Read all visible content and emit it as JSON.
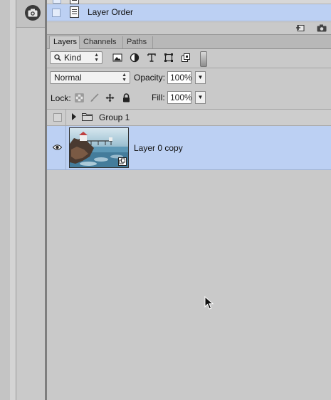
{
  "history": {
    "item_label": "Layer Order"
  },
  "layers_panel": {
    "tabs": [
      {
        "label": "Layers",
        "active": true
      },
      {
        "label": "Channels",
        "active": false
      },
      {
        "label": "Paths",
        "active": false
      }
    ],
    "filter": {
      "kind_label": "Kind"
    },
    "blend_mode": "Normal",
    "opacity_label": "Opacity:",
    "opacity_value": "100%",
    "lock_label": "Lock:",
    "fill_label": "Fill:",
    "fill_value": "100%",
    "layers": [
      {
        "type": "group",
        "label": "Group 1",
        "visible": false
      },
      {
        "type": "smart-object",
        "label": "Layer 0 copy",
        "visible": true,
        "selected": true
      }
    ]
  },
  "colors": {
    "selection": "#bcd0f3",
    "panel_bg": "#c9c9c9"
  },
  "icons": [
    "camera-icon",
    "document-icon",
    "new-state-icon",
    "snapshot-icon",
    "image-filter-icon",
    "adjustment-filter-icon",
    "type-filter-icon",
    "shape-filter-icon",
    "smart-object-filter-icon",
    "lock-pixels-icon",
    "lock-brush-icon",
    "lock-position-icon",
    "lock-all-icon",
    "folder-icon",
    "eye-icon",
    "smart-object-badge-icon",
    "cursor-icon"
  ]
}
